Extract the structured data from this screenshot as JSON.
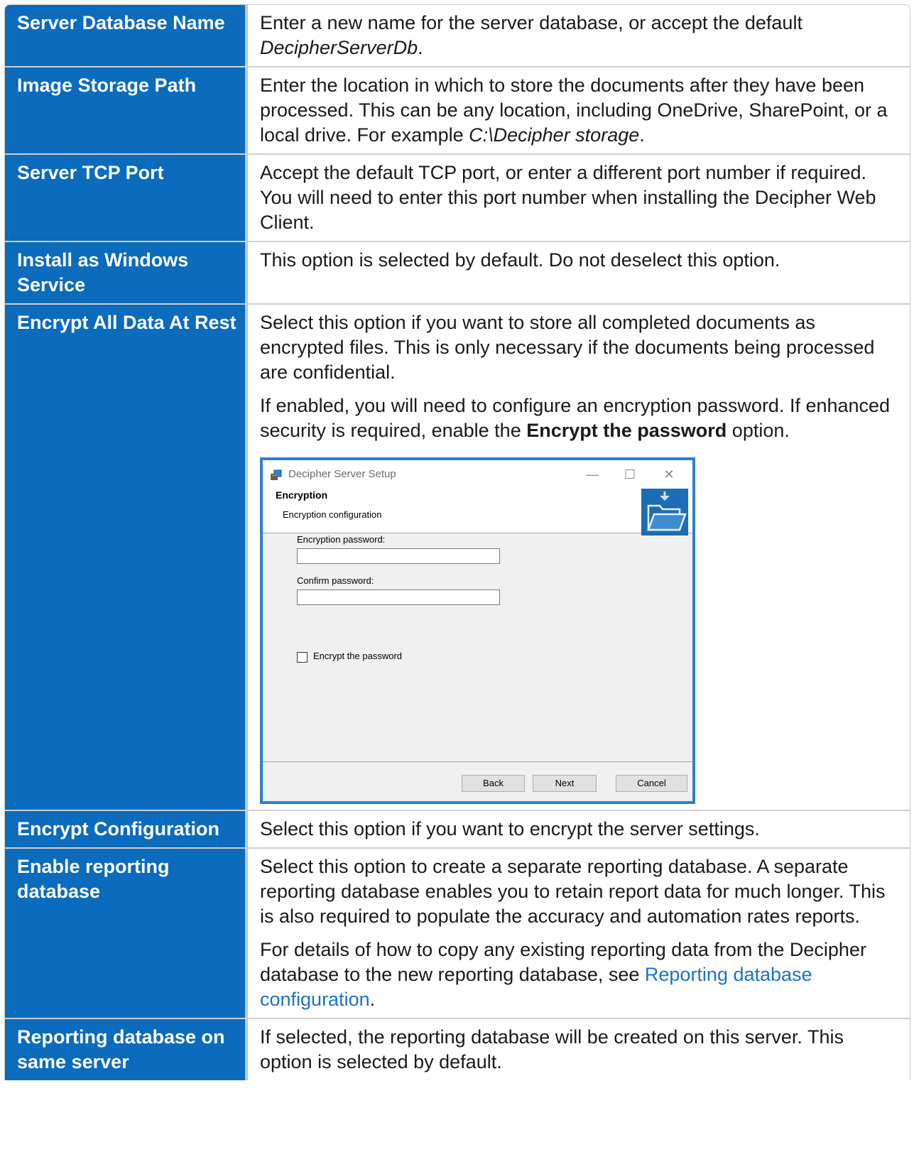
{
  "rows": [
    {
      "label": "Server Database Name",
      "paragraphs": [
        [
          "Enter a new name for the server database, or accept the default ",
          {
            "i": "DecipherServerDb"
          },
          "."
        ]
      ]
    },
    {
      "label": "Image Storage Path",
      "paragraphs": [
        [
          "Enter the location in which to store the documents after they have been processed. This can be any location, including OneDrive, SharePoint, or a local drive. For example ",
          {
            "i": "C:\\Decipher storage"
          },
          "."
        ]
      ]
    },
    {
      "label": "Server TCP Port",
      "paragraphs": [
        [
          "Accept the default TCP port, or enter a different port number if required. You will need to enter this port number when installing the Decipher Web Client."
        ]
      ]
    },
    {
      "label": "Install as Windows Service",
      "paragraphs": [
        [
          "This option is selected by default. Do not deselect this option."
        ]
      ]
    },
    {
      "label": "Encrypt All Data At Rest",
      "paragraphs": [
        [
          "Select this option if you want to store all completed documents as encrypted files. This is only necessary if the documents being processed are confidential."
        ],
        [
          "If enabled, you will need to configure an encryption password. If enhanced security is required, enable the ",
          {
            "b": "Encrypt the password"
          },
          " option."
        ]
      ],
      "dialog": true
    },
    {
      "label": "Encrypt Configuration",
      "paragraphs": [
        [
          "Select this option if you want to encrypt the server settings."
        ]
      ]
    },
    {
      "label": "Enable reporting database",
      "paragraphs": [
        [
          "Select this option to create a separate reporting database. A separate reporting database enables you to retain report data for much longer. This is also required to populate the accuracy and automation rates reports."
        ],
        [
          "For details of how to copy any existing reporting data from the Decipher database to the new reporting database, see ",
          {
            "a": "Reporting database configuration"
          },
          "."
        ]
      ]
    },
    {
      "label": "Reporting database on same server",
      "paragraphs": [
        [
          "If selected, the reporting database will be created on this server. This option is selected by default."
        ]
      ]
    }
  ],
  "dialog": {
    "title": "Decipher Server Setup",
    "header_title": "Encryption",
    "header_subtitle": "Encryption configuration",
    "password_label": "Encryption password:",
    "confirm_label": "Confirm password:",
    "password_value": "",
    "confirm_value": "",
    "checkbox_label": "Encrypt the password",
    "checkbox_checked": false,
    "back_label": "Back",
    "next_label": "Next",
    "cancel_label": "Cancel"
  }
}
